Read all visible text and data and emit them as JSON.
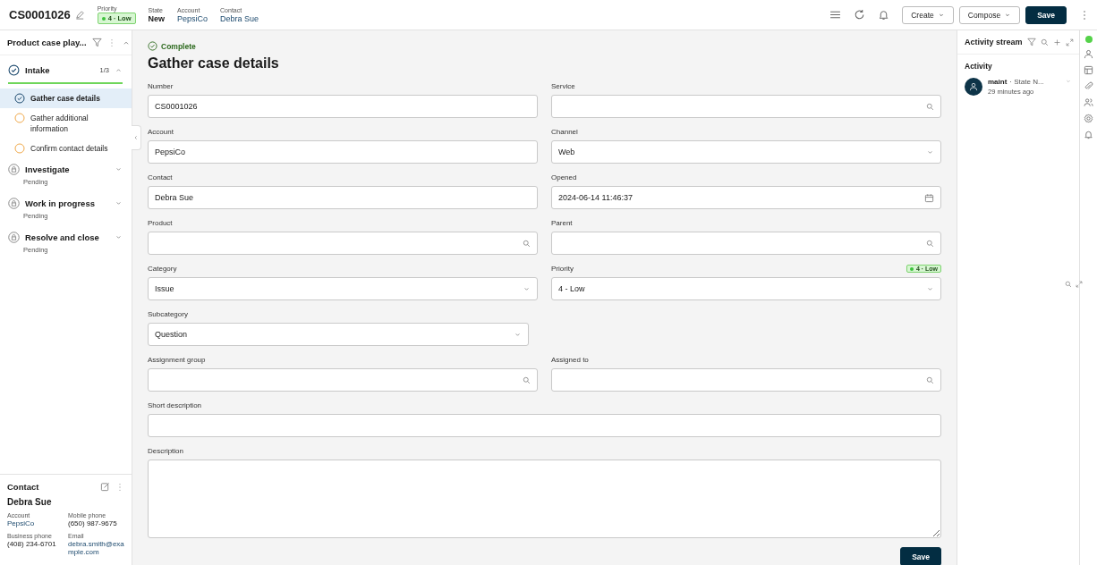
{
  "header": {
    "case_number": "CS0001026",
    "fields": [
      {
        "kind": "badge",
        "label": "Priority",
        "value": "4 · Low",
        "color": "#3cc23c"
      },
      {
        "kind": "text",
        "label": "State",
        "value": "New"
      },
      {
        "kind": "link",
        "label": "Account",
        "value": "PepsiCo"
      },
      {
        "kind": "link",
        "label": "Contact",
        "value": "Debra Sue"
      }
    ],
    "buttons": [
      {
        "label": "Create",
        "kind": "menu"
      },
      {
        "label": "Compose",
        "kind": "menu"
      },
      {
        "label": "Save",
        "kind": "primary"
      }
    ]
  },
  "playbook": {
    "title": "Product case play...",
    "stages": [
      {
        "name": "Intake",
        "locked": false,
        "count": "1/3",
        "expanded": true,
        "tasks": [
          {
            "name": "Gather case details",
            "complete": true,
            "selected": true
          },
          {
            "name": "Gather additional information",
            "complete": false,
            "selected": false
          },
          {
            "name": "Confirm contact details",
            "complete": false,
            "selected": false
          }
        ]
      },
      {
        "name": "Investigate",
        "locked": true,
        "subtitle": "Pending",
        "expanded": false
      },
      {
        "name": "Work in progress",
        "locked": true,
        "subtitle": "Pending",
        "expanded": false
      },
      {
        "name": "Resolve and close",
        "locked": true,
        "subtitle": "Pending",
        "expanded": false
      }
    ]
  },
  "contact_card": {
    "title": "Contact",
    "name": "Debra Sue",
    "fields": [
      {
        "label": "Account",
        "value": "PepsiCo",
        "kind": "link"
      },
      {
        "label": "Mobile phone",
        "value": "(650) 987-9675",
        "kind": "text"
      },
      {
        "label": "Business phone",
        "value": "(408) 234-6701",
        "kind": "text"
      },
      {
        "label": "Email",
        "value": "debra.smith@example.com",
        "kind": "link"
      }
    ]
  },
  "task": {
    "status": "Complete",
    "title": "Gather case details",
    "rows": [
      [
        {
          "label": "Number",
          "kind": "text",
          "value": "CS0001026"
        },
        {
          "label": "Service",
          "kind": "search"
        }
      ],
      [
        {
          "label": "Account",
          "kind": "text",
          "value": "PepsiCo"
        },
        {
          "label": "Channel",
          "kind": "select",
          "value": "Web"
        }
      ],
      [
        {
          "label": "Contact",
          "kind": "text",
          "value": "Debra Sue"
        },
        {
          "label": "Opened",
          "kind": "date",
          "value": "2024-06-14 11:46:37"
        }
      ],
      [
        {
          "label": "Product",
          "kind": "search"
        },
        {
          "label": "Parent",
          "kind": "search"
        }
      ],
      [
        {
          "label": "Category",
          "kind": "select",
          "value": "Issue"
        },
        {
          "label": "Priority",
          "kind": "select",
          "value": "4 - Low",
          "badge": "4 · Low"
        }
      ],
      [
        {
          "label": "Subcategory",
          "kind": "select",
          "value": "Question"
        }
      ],
      [
        {
          "label": "Assignment group",
          "kind": "search"
        },
        {
          "label": "Assigned to",
          "kind": "search"
        }
      ],
      [
        {
          "label": "Short description",
          "kind": "text",
          "wide": true
        }
      ],
      [
        {
          "label": "Description",
          "kind": "textarea",
          "wide": true
        }
      ]
    ],
    "save": "Save"
  },
  "activity": {
    "title": "Activity stream",
    "section": "Activity",
    "entries": [
      {
        "user": "maint",
        "summary": "· State N...",
        "time": "29 minutes ago"
      }
    ]
  }
}
